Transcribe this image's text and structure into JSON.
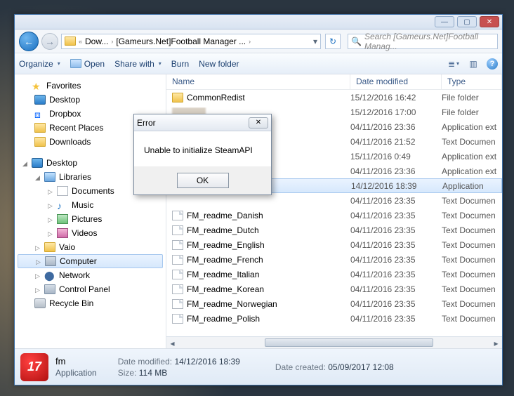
{
  "breadcrumb": {
    "part1": "Dow...",
    "part2": "[Gameurs.Net]Football Manager ..."
  },
  "search": {
    "placeholder": "Search [Gameurs.Net]Football Manag..."
  },
  "toolbar": {
    "organize": "Organize",
    "open": "Open",
    "share": "Share with",
    "burn": "Burn",
    "newfolder": "New folder"
  },
  "tree": {
    "favorites": "Favorites",
    "desktop": "Desktop",
    "dropbox": "Dropbox",
    "recent": "Recent Places",
    "downloads": "Downloads",
    "desktop2": "Desktop",
    "libraries": "Libraries",
    "documents": "Documents",
    "music": "Music",
    "pictures": "Pictures",
    "videos": "Videos",
    "vaio": "Vaio",
    "computer": "Computer",
    "network": "Network",
    "control": "Control Panel",
    "recycle": "Recycle Bin"
  },
  "columns": {
    "name": "Name",
    "date": "Date modified",
    "type": "Type"
  },
  "files": [
    {
      "name": "CommonRedist",
      "date": "15/12/2016 16:42",
      "type": "File folder",
      "icon": "folder"
    },
    {
      "name": "",
      "date": "15/12/2016 17:00",
      "type": "File folder",
      "icon": "blur"
    },
    {
      "name": "",
      "date": "04/11/2016 23:36",
      "type": "Application ext",
      "icon": "hidden"
    },
    {
      "name": "",
      "date": "04/11/2016 21:52",
      "type": "Text Documen",
      "icon": "hidden"
    },
    {
      "name": "",
      "date": "15/11/2016 0:49",
      "type": "Application ext",
      "icon": "hidden"
    },
    {
      "name": "",
      "date": "04/11/2016 23:36",
      "type": "Application ext",
      "icon": "hidden"
    },
    {
      "name": "",
      "date": "14/12/2016 18:39",
      "type": "Application",
      "icon": "hidden",
      "selected": true
    },
    {
      "name": "",
      "date": "04/11/2016 23:35",
      "type": "Text Documen",
      "icon": "hidden"
    },
    {
      "name": "FM_readme_Danish",
      "date": "04/11/2016 23:35",
      "type": "Text Documen",
      "icon": "file"
    },
    {
      "name": "FM_readme_Dutch",
      "date": "04/11/2016 23:35",
      "type": "Text Documen",
      "icon": "file"
    },
    {
      "name": "FM_readme_English",
      "date": "04/11/2016 23:35",
      "type": "Text Documen",
      "icon": "file"
    },
    {
      "name": "FM_readme_French",
      "date": "04/11/2016 23:35",
      "type": "Text Documen",
      "icon": "file"
    },
    {
      "name": "FM_readme_Italian",
      "date": "04/11/2016 23:35",
      "type": "Text Documen",
      "icon": "file"
    },
    {
      "name": "FM_readme_Korean",
      "date": "04/11/2016 23:35",
      "type": "Text Documen",
      "icon": "file"
    },
    {
      "name": "FM_readme_Norwegian",
      "date": "04/11/2016 23:35",
      "type": "Text Documen",
      "icon": "file"
    },
    {
      "name": "FM_readme_Polish",
      "date": "04/11/2016 23:35",
      "type": "Text Documen",
      "icon": "file"
    }
  ],
  "details": {
    "name": "fm",
    "type": "Application",
    "mod_lbl": "Date modified:",
    "mod_val": "14/12/2016 18:39",
    "created_lbl": "Date created:",
    "created_val": "05/09/2017 12:08",
    "size_lbl": "Size:",
    "size_val": "114 MB",
    "icon_text": "17"
  },
  "dialog": {
    "title": "Error",
    "message": "Unable to initialize SteamAPI",
    "ok": "OK"
  }
}
